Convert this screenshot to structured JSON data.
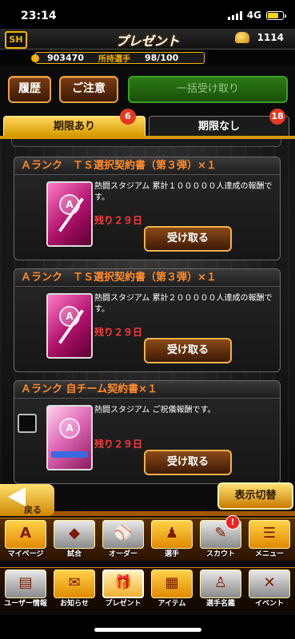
{
  "status": {
    "time": "23:14",
    "network": "4G"
  },
  "header": {
    "logo": "SH",
    "title": "プレゼント",
    "coins": "1114"
  },
  "info": {
    "points": "903470",
    "players_label": "所持選手",
    "players_count": "98/100"
  },
  "toolbar": {
    "history": "履歴",
    "notice": "ご注意",
    "receive_all": "一括受け取り"
  },
  "tabs": [
    {
      "label": "期限あり",
      "badge": "6"
    },
    {
      "label": "期限なし",
      "badge": "18"
    }
  ],
  "presents": [
    {
      "title": "Ａランク　ＴＳ選択契約書（第３弾）×１",
      "desc": "熱闘スタジアム 累計１０００００人達成の報酬です。",
      "remain": "残り２９日",
      "button": "受け取る",
      "icon_text": "A"
    },
    {
      "title": "Ａランク　ＴＳ選択契約書（第３弾）×１",
      "desc": "熱闘スタジアム 累計２０００００人達成の報酬です。",
      "remain": "残り２９日",
      "button": "受け取る",
      "icon_text": "A"
    },
    {
      "title": "Ａランク 自チーム契約書×１",
      "desc": "熱闘スタジアム ご祝儀報酬です。",
      "remain": "残り２９日",
      "button": "受け取る",
      "icon_text": "A"
    }
  ],
  "nav": {
    "back": "戻る",
    "switch": "表示切替"
  },
  "menu1": [
    {
      "label": "マイページ",
      "glyph": "A"
    },
    {
      "label": "試合",
      "glyph": "◆"
    },
    {
      "label": "オーダー",
      "glyph": "⚾"
    },
    {
      "label": "選手",
      "glyph": "♟"
    },
    {
      "label": "スカウト",
      "glyph": "✎",
      "badge": "!"
    },
    {
      "label": "メニュー",
      "glyph": "☰"
    }
  ],
  "menu2": [
    {
      "label": "ユーザー情報",
      "glyph": "▤"
    },
    {
      "label": "お知らせ",
      "glyph": "✉"
    },
    {
      "label": "プレゼント",
      "glyph": "🎁"
    },
    {
      "label": "アイテム",
      "glyph": "▦"
    },
    {
      "label": "選手名鑑",
      "glyph": "♙"
    },
    {
      "label": "イベント",
      "glyph": "✕"
    }
  ]
}
